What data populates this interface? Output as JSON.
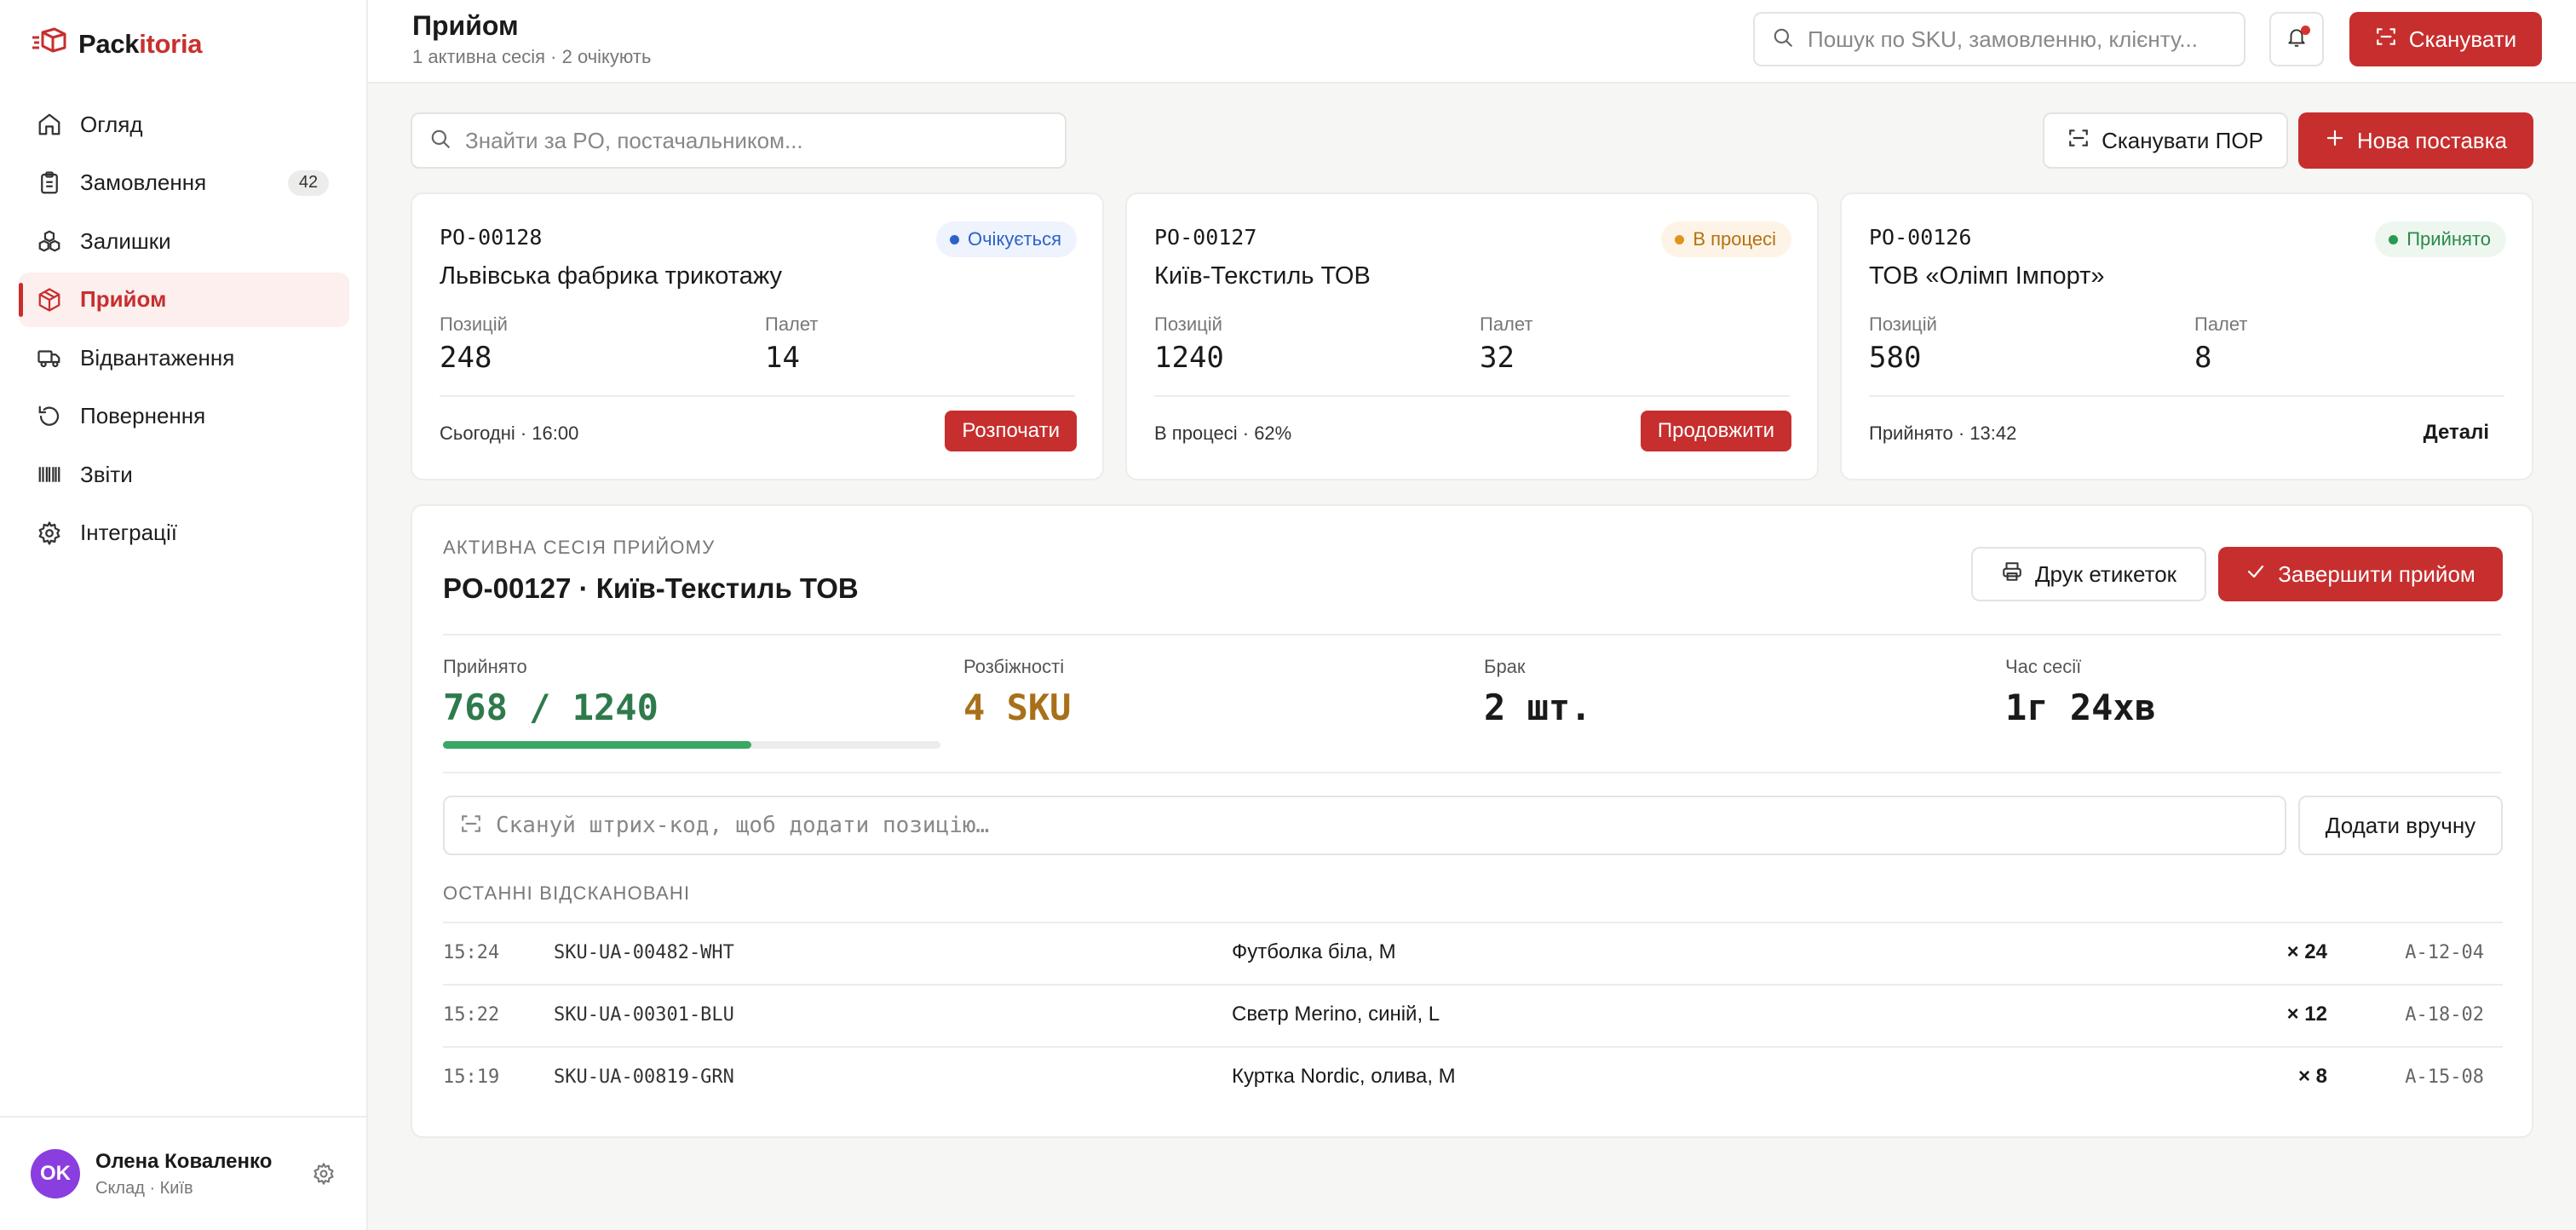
{
  "app": {
    "logo_part1": "Pack",
    "logo_part2": "itoria",
    "accent": "#c62f2e"
  },
  "sidebar": {
    "items": [
      {
        "label": "Огляд",
        "icon": "home-icon"
      },
      {
        "label": "Замовлення",
        "icon": "clipboard-icon",
        "badge": "42"
      },
      {
        "label": "Залишки",
        "icon": "boxes-icon"
      },
      {
        "label": "Прийом",
        "icon": "package-icon",
        "active": true
      },
      {
        "label": "Відвантаження",
        "icon": "truck-icon"
      },
      {
        "label": "Повернення",
        "icon": "return-icon"
      },
      {
        "label": "Звіти",
        "icon": "barcode-icon"
      },
      {
        "label": "Інтеграції",
        "icon": "gear-icon"
      }
    ],
    "user": {
      "initials": "OK",
      "name": "Олена Коваленко",
      "role": "Склад · Київ"
    }
  },
  "header": {
    "title": "Прийом",
    "subtitle": "1 активна сесія · 2 очікують",
    "search_placeholder": "Пошук по SKU, замовленню, клієнту...",
    "scan_label": "Сканувати"
  },
  "toolbar": {
    "filter_placeholder": "Знайти за PO, постачальником...",
    "scan_por_label": "Сканувати ПОР",
    "new_supply_label": "Нова поставка"
  },
  "cards": [
    {
      "po": "PO-00128",
      "supplier": "Львівська фабрика трикотажу",
      "status": "Очікується",
      "status_type": "waiting",
      "positions_label": "Позицій",
      "positions": "248",
      "pallets_label": "Палет",
      "pallets": "14",
      "footer": "Сьогодні · 16:00",
      "action": "Розпочати"
    },
    {
      "po": "PO-00127",
      "supplier": "Київ-Текстиль ТОВ",
      "status": "В процесі",
      "status_type": "progress",
      "positions_label": "Позицій",
      "positions": "1240",
      "pallets_label": "Палет",
      "pallets": "32",
      "footer": "В процесі · 62%",
      "action": "Продовжити"
    },
    {
      "po": "PO-00126",
      "supplier": "ТОВ «Олімп Імпорт»",
      "status": "Прийнято",
      "status_type": "accepted",
      "positions_label": "Позицій",
      "positions": "580",
      "pallets_label": "Палет",
      "pallets": "8",
      "footer": "Прийнято · 13:42",
      "action": "Деталі"
    }
  ],
  "session": {
    "caption": "АКТИВНА СЕСІЯ ПРИЙОМУ",
    "title": "PO-00127 · Київ-Текстиль ТОВ",
    "print_label": "Друк етикеток",
    "finish_label": "Завершити прийом",
    "kpis": {
      "accepted_label": "Прийнято",
      "accepted_value": "768 / 1240",
      "discrepancy_label": "Розбіжності",
      "discrepancy_value": "4 SKU",
      "defect_label": "Брак",
      "defect_value": "2 шт.",
      "time_label": "Час сесії",
      "time_value": "1г 24хв"
    },
    "progress_fraction": 0.62,
    "scan_placeholder": "Скануй штрих-код, щоб додати позицію…",
    "manual_label": "Додати вручну",
    "recent_caption": "ОСТАННІ ВІДСКАНОВАНІ",
    "recent": [
      {
        "time": "15:24",
        "sku": "SKU-UA-00482-WHT",
        "name": "Футболка біла, M",
        "qty": "× 24",
        "loc": "A-12-04"
      },
      {
        "time": "15:22",
        "sku": "SKU-UA-00301-BLU",
        "name": "Светр Merino, синій, L",
        "qty": "× 12",
        "loc": "A-18-02"
      },
      {
        "time": "15:19",
        "sku": "SKU-UA-00819-GRN",
        "name": "Куртка Nordic, олива, M",
        "qty": "× 8",
        "loc": "A-15-08"
      }
    ]
  },
  "colors": {
    "accepted_green": "#2f7a4c",
    "discrepancy_amber": "#a8701a",
    "progress_fill": "#3aa865"
  }
}
